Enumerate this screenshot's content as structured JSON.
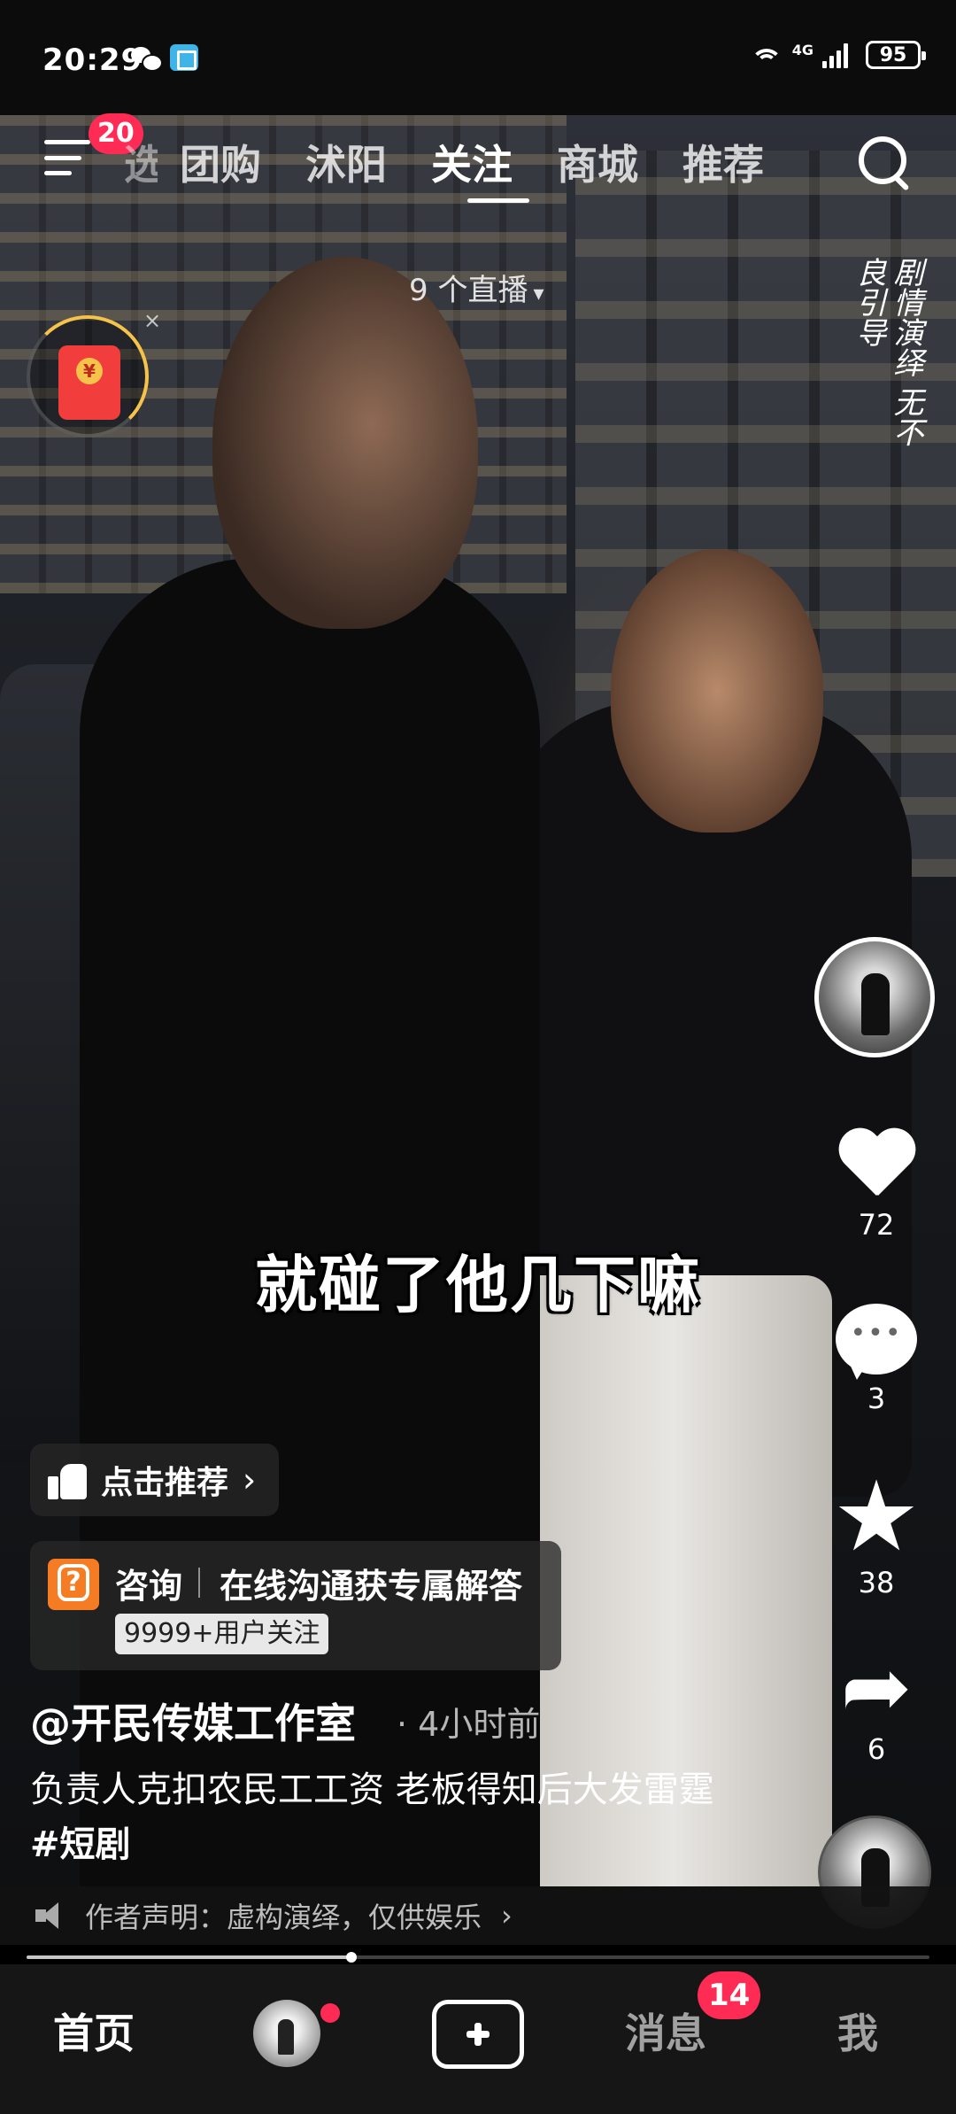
{
  "status_bar": {
    "time": "20:29",
    "network": "4G",
    "battery": "95"
  },
  "top_nav": {
    "menu_badge": "20",
    "tabs": [
      {
        "label": "选"
      },
      {
        "label": "团购"
      },
      {
        "label": "沭阳"
      },
      {
        "label": "关注"
      },
      {
        "label": "商城"
      },
      {
        "label": "推荐"
      }
    ],
    "active_tab": "关注"
  },
  "live": {
    "count_label": "9 个直播"
  },
  "redpacket": {
    "close": "×"
  },
  "watermark": {
    "text": "剧情演绎 无不良引导"
  },
  "video": {
    "subtitle": "就碰了他几下嘛",
    "progress": 0.36
  },
  "actions": {
    "likes": "72",
    "comments": "3",
    "favorites": "38",
    "shares": "6"
  },
  "recommend": {
    "label": "点击推荐",
    "chevron": "›"
  },
  "consult": {
    "title": "咨询",
    "desc": "在线沟通获专属解答",
    "tag": "9999+用户关注"
  },
  "post": {
    "author": "@开民传媒工作室",
    "time": "4小时前",
    "description": "负责人克扣农民工工资 老板得知后大发雷霆",
    "hashtag": "#短剧"
  },
  "declaration": {
    "text": "作者声明：虚构演绎，仅供娱乐",
    "chevron": "›"
  },
  "bottom_nav": {
    "home": "首页",
    "messages": "消息",
    "messages_badge": "14",
    "me": "我"
  },
  "colors": {
    "accent_red": "#fe2c55",
    "consult_orange": "#f57c23",
    "redpacket_red": "#f23d3d"
  }
}
